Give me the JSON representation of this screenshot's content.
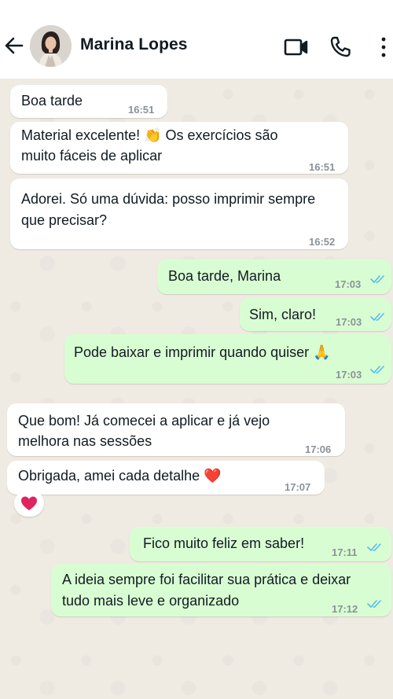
{
  "contact": {
    "name": "Marina Lopes"
  },
  "messages": [
    {
      "dir": "in",
      "text": "Boa tarde",
      "time": "16:51"
    },
    {
      "dir": "in",
      "text": "Material excelente! 👏 Os exercícios são muito fáceis de aplicar",
      "line1": "Material excelente! 👏 Os exercícios são",
      "line2": "muito fáceis de aplicar",
      "time": "16:51"
    },
    {
      "dir": "in",
      "line1": "Adorei. Só uma dúvida: posso imprimir sempre",
      "line2": "que precisar?",
      "time": "16:52"
    },
    {
      "dir": "out",
      "text": "Boa tarde, Marina",
      "time": "17:03",
      "status": "read"
    },
    {
      "dir": "out",
      "text": "Sim, claro!",
      "time": "17:03",
      "status": "read"
    },
    {
      "dir": "out",
      "text": "Pode baixar e imprimir quando quiser 🙏",
      "time": "17:03",
      "status": "read"
    },
    {
      "dir": "in",
      "line1": "Que bom! Já comecei a aplicar e já vejo",
      "line2": "melhora nas sessões",
      "time": "17:06"
    },
    {
      "dir": "in",
      "text": "Obrigada, amei cada detalhe ❤️",
      "time": "17:07",
      "reaction": "❤️"
    },
    {
      "dir": "out",
      "text": "Fico muito feliz em saber!",
      "time": "17:11",
      "status": "read"
    },
    {
      "dir": "out",
      "line1": "A ideia sempre foi facilitar sua prática e deixar",
      "line2": "tudo mais leve e organizado",
      "time": "17:12",
      "status": "read"
    }
  ],
  "icons": {
    "back": "arrow-left-icon",
    "video": "video-camera-icon",
    "call": "phone-icon",
    "menu": "more-vertical-icon",
    "read": "double-check-icon"
  },
  "colors": {
    "incoming_bubble": "#ffffff",
    "outgoing_bubble": "#d9fdd3",
    "read_ticks": "#53bdeb",
    "chat_background": "#efeae2"
  }
}
